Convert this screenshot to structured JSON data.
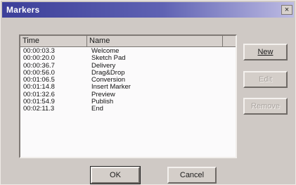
{
  "window": {
    "title": "Markers",
    "close_glyph": "×"
  },
  "list": {
    "columns": [
      "Time",
      "Name"
    ],
    "rows": [
      {
        "time": "00:00:03.3",
        "name": "Welcome"
      },
      {
        "time": "00:00:20.0",
        "name": "Sketch Pad"
      },
      {
        "time": "00:00:36.7",
        "name": "Delivery"
      },
      {
        "time": "00:00:56.0",
        "name": "Drag&Drop"
      },
      {
        "time": "00:01:06.5",
        "name": "Conversion"
      },
      {
        "time": "00:01:14.8",
        "name": "Insert Marker"
      },
      {
        "time": "00:01:32.6",
        "name": "Preview"
      },
      {
        "time": "00:01:54.9",
        "name": "Publish"
      },
      {
        "time": "00:02:11.3",
        "name": "End"
      }
    ]
  },
  "buttons": {
    "new": "New",
    "edit": "Edit",
    "remove": "Remove",
    "ok": "OK",
    "cancel": "Cancel"
  }
}
